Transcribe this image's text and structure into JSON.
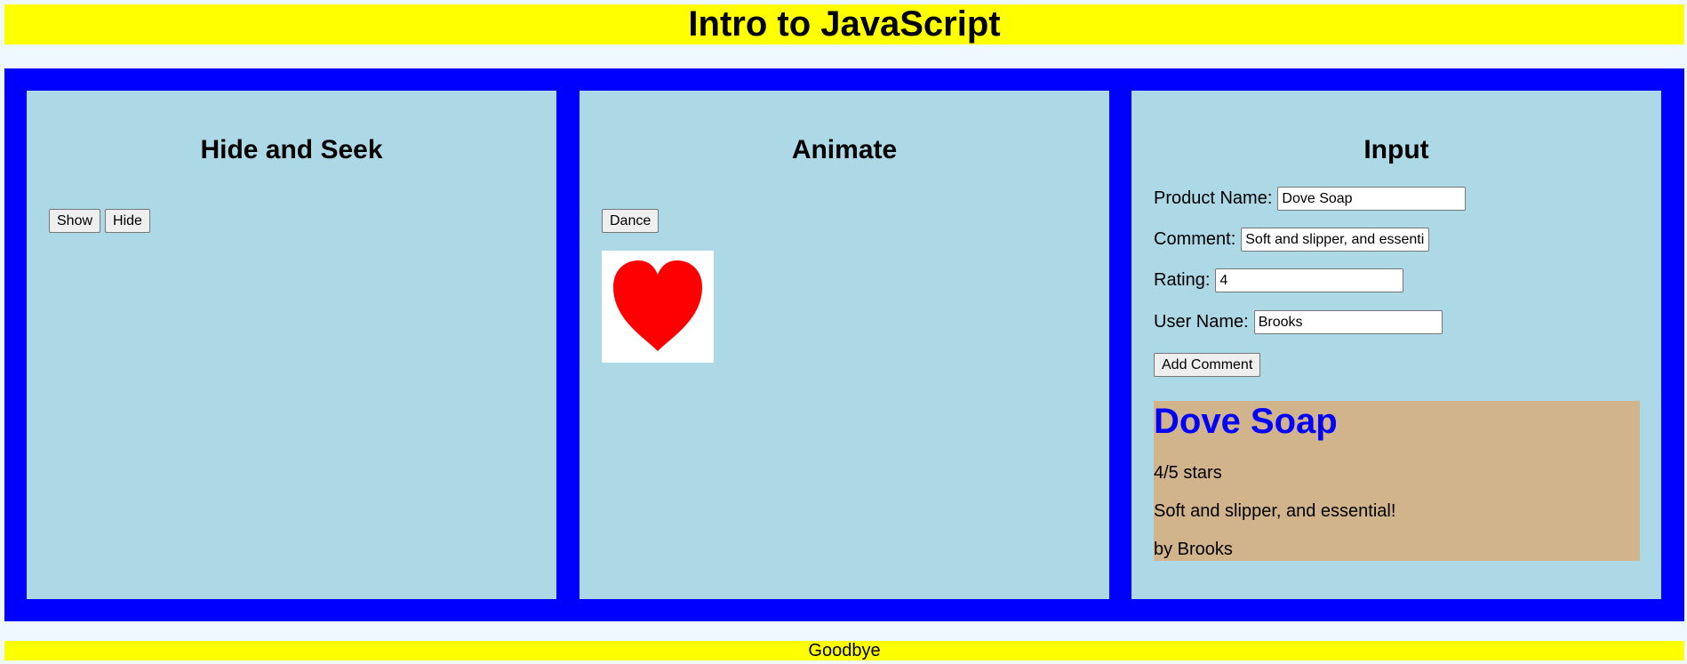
{
  "header": {
    "title": "Intro to JavaScript"
  },
  "panels": {
    "hide_seek": {
      "title": "Hide and Seek",
      "show_label": "Show",
      "hide_label": "Hide"
    },
    "animate": {
      "title": "Animate",
      "dance_label": "Dance",
      "image": "heart-icon"
    },
    "input": {
      "title": "Input",
      "fields": {
        "product_name": {
          "label": "Product Name:",
          "value": "Dove Soap"
        },
        "comment": {
          "label": "Comment:",
          "value": "Soft and slipper, and essential!"
        },
        "rating": {
          "label": "Rating:",
          "value": "4"
        },
        "user_name": {
          "label": "User Name:",
          "value": "Brooks"
        }
      },
      "add_label": "Add Comment",
      "review": {
        "product": "Dove Soap",
        "stars": "4/5 stars",
        "comment": "Soft and slipper, and essential!",
        "byline": "by Brooks"
      }
    }
  },
  "footer": {
    "text": "Goodbye"
  },
  "colors": {
    "banner": "#ffff00",
    "frame": "#0000ff",
    "panel": "#add8e6",
    "review_bg": "#d2b48c",
    "review_title": "#0000ff",
    "heart": "#ff0000"
  }
}
